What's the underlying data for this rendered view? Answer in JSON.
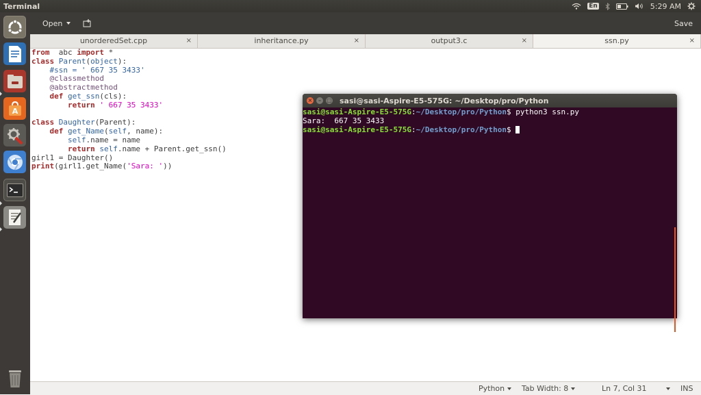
{
  "top_panel": {
    "app_title": "Terminal",
    "keyboard_layout": "En",
    "time": "5:29 AM",
    "icons": [
      "wifi-icon",
      "bluetooth-icon",
      "battery-icon",
      "volume-icon",
      "settings-gear-icon"
    ]
  },
  "launcher": {
    "items": [
      "ubuntu-dash-icon",
      "libreoffice-writer-icon",
      "files-icon",
      "software-center-icon",
      "system-settings-icon",
      "chromium-icon",
      "terminal-icon",
      "text-editor-icon",
      "trash-icon"
    ]
  },
  "toolbar": {
    "open_label": "Open",
    "save_label": "Save"
  },
  "tabs": [
    {
      "label": "unorderedSet.cpp"
    },
    {
      "label": "inheritance.py"
    },
    {
      "label": "output3.c"
    },
    {
      "label": "ssn.py",
      "active": true
    }
  ],
  "tab_close_glyph": "×",
  "editor": {
    "lines": [
      "from  abc import *",
      "class Parent(object):",
      "    #ssn = ' 667 35 3433'",
      "    @classmethod",
      "    @abstractmethod",
      "    def get_ssn(cls):",
      "        return ' 667 35 3433'",
      "",
      "class Daughter(Parent):",
      "    def get_Name(self, name):",
      "        self.name = name",
      "        return self.name + Parent.get_ssn()",
      "girl1 = Daughter()",
      "print(girl1.get_Name('Sara: '))"
    ]
  },
  "status_bar": {
    "language": "Python",
    "tab_width": "Tab Width: 8",
    "position": "Ln 7, Col 31",
    "mode": "INS"
  },
  "terminal": {
    "title": "sasi@sasi-Aspire-E5-575G: ~/Desktop/pro/Python",
    "prompt_user": "sasi@sasi-Aspire-E5-575G",
    "prompt_path": "~/Desktop/pro/Python",
    "command": "python3 ssn.py",
    "output": "Sara:  667 35 3433",
    "colors": {
      "background": "#300a24",
      "user": "#8ae234",
      "path": "#729fcf"
    }
  }
}
